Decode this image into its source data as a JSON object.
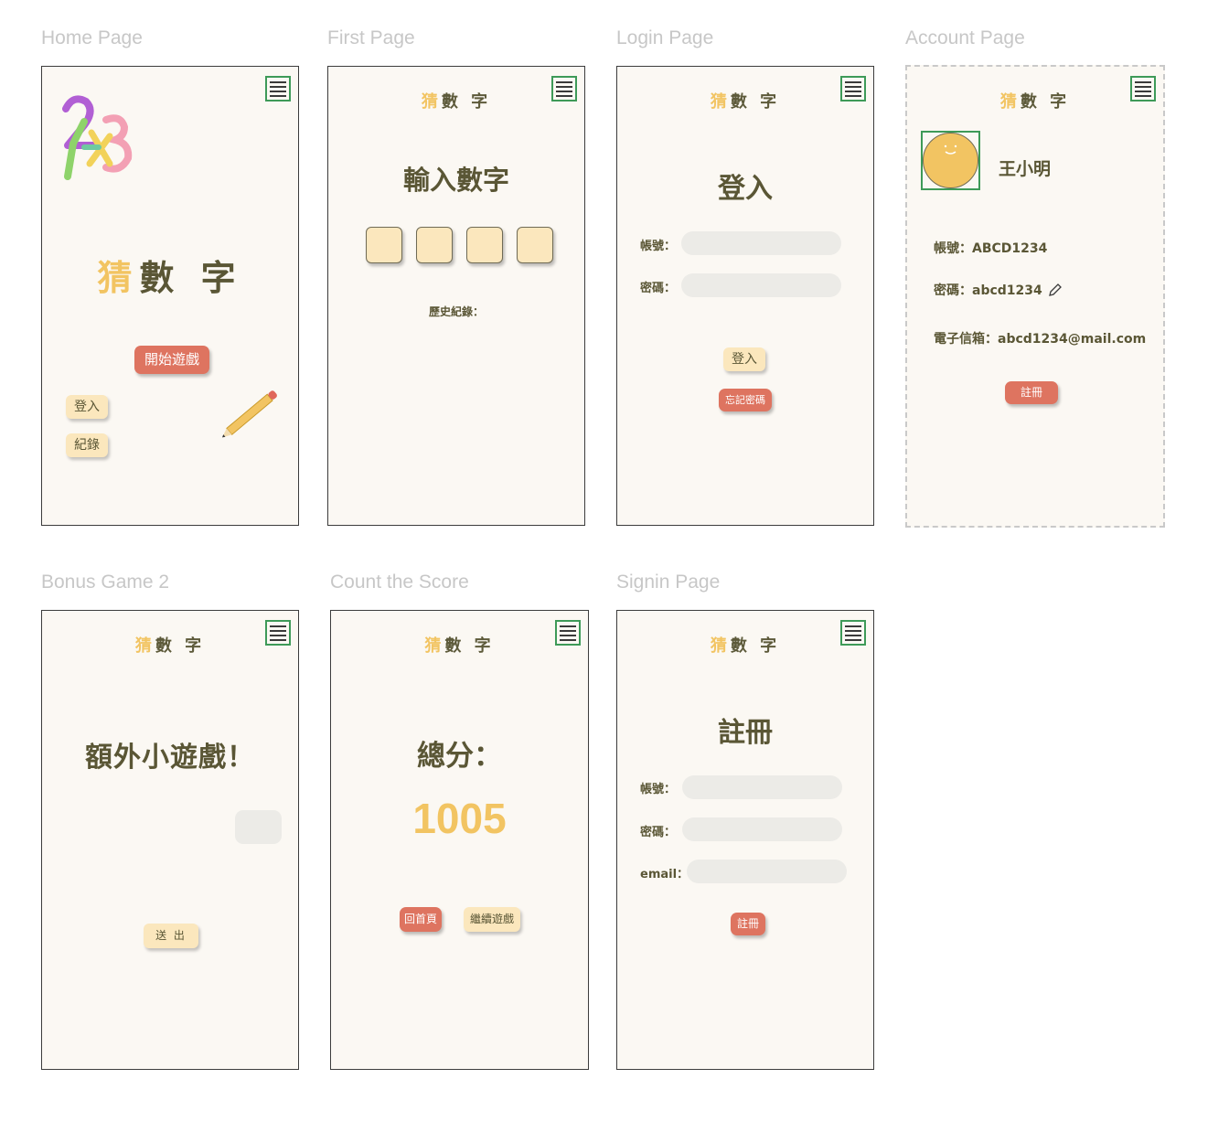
{
  "brand": {
    "guess": "猜",
    "rest": "數 字"
  },
  "home": {
    "label": "Home Page",
    "title_guess": "猜",
    "title_rest": "數 字",
    "start_button": "開始遊戲",
    "login_button": "登入",
    "records_button": "紀錄"
  },
  "first": {
    "label": "First Page",
    "heading": "輸入數字",
    "history_label": "歷史紀錄："
  },
  "login": {
    "label": "Login Page",
    "heading": "登入",
    "account_label": "帳號：",
    "password_label": "密碼：",
    "login_button": "登入",
    "forgot_button": "忘記密碼"
  },
  "account": {
    "label": "Account Page",
    "username": "王小明",
    "account_line": "帳號：ABCD1234",
    "password_line": "密碼：abcd1234",
    "email_line": "電子信箱：abcd1234@mail.com",
    "register_button": "註冊"
  },
  "bonus": {
    "label": "Bonus Game 2",
    "heading": "額外小遊戲！",
    "submit_button": "送 出"
  },
  "score": {
    "label": "Count the Score",
    "heading": "總分：",
    "value": "1005",
    "home_button": "回首頁",
    "continue_button": "繼續遊戲"
  },
  "signin": {
    "label": "Signin Page",
    "heading": "註冊",
    "account_label": "帳號：",
    "password_label": "密碼：",
    "email_label": "email：",
    "register_button": "註冊"
  },
  "colors": {
    "accent_yellow": "#f2c462",
    "olive_text": "#5a5635",
    "button_red": "#de7460",
    "button_cream": "#fbe7bd",
    "menu_green": "#3e9a58",
    "frame_bg": "#fbf8f3"
  }
}
